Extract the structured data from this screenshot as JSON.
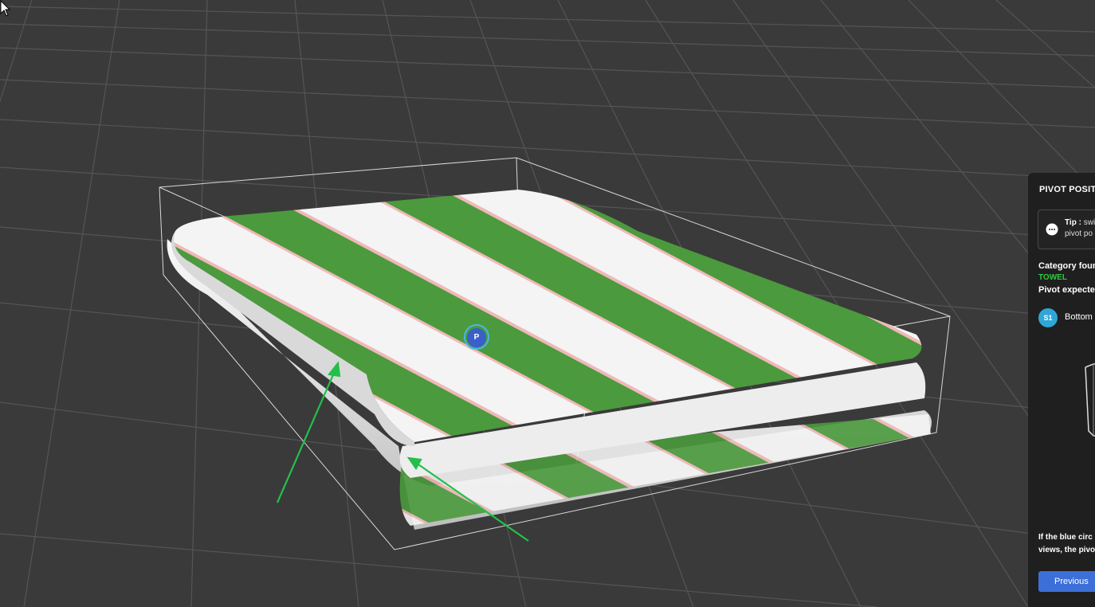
{
  "panel": {
    "title": "PIVOT POSITI",
    "tip_label": "Tip :",
    "tip_line1": "swi",
    "tip_line2": "pivot po",
    "category_label": "Category foun",
    "category_value": "TOWEL",
    "pivot_label": "Pivot expecte",
    "step_badge": "S1",
    "step_text": "Bottom",
    "note_line1": "If the blue circ",
    "note_line2": "views, the pivo",
    "previous_button": "Previous"
  },
  "scene": {
    "pivot_marker": "P",
    "towel_colors": {
      "stripe": "#4a9a3c",
      "base": "#f2f2f2",
      "shadow": "#c9c9c9"
    },
    "arrow_color": "#22c04a",
    "pivot_color": "#3a5fc8"
  },
  "icons": {
    "tip": "speech-bubble-icon",
    "cursor": "mouse-pointer-icon"
  }
}
